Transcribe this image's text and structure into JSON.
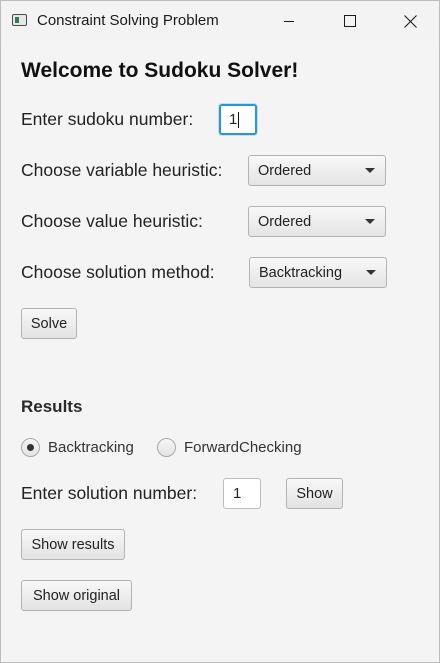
{
  "window": {
    "title": "Constraint Solving Problem",
    "app_icon": "java-app-icon",
    "controls": {
      "minimize_icon": "minimize-icon",
      "maximize_icon": "maximize-icon",
      "close_icon": "close-icon"
    }
  },
  "form": {
    "heading": "Welcome to Sudoku Solver!",
    "sudoku_number_label": "Enter sudoku number:",
    "sudoku_number_value": "1",
    "variable_heuristic_label": "Choose variable heuristic:",
    "variable_heuristic_value": "Ordered",
    "value_heuristic_label": "Choose value heuristic:",
    "value_heuristic_value": "Ordered",
    "solution_method_label": "Choose solution method:",
    "solution_method_value": "Backtracking",
    "solve_label": "Solve"
  },
  "results": {
    "title": "Results",
    "radio_options": [
      {
        "label": "Backtracking",
        "selected": true
      },
      {
        "label": "ForwardChecking",
        "selected": false
      }
    ],
    "solution_number_label": "Enter solution number:",
    "solution_number_value": "1",
    "show_label": "Show",
    "show_results_label": "Show results",
    "show_original_label": "Show original"
  },
  "colors": {
    "focus_accent": "#2c95d6",
    "background": "#f4f4f4"
  }
}
